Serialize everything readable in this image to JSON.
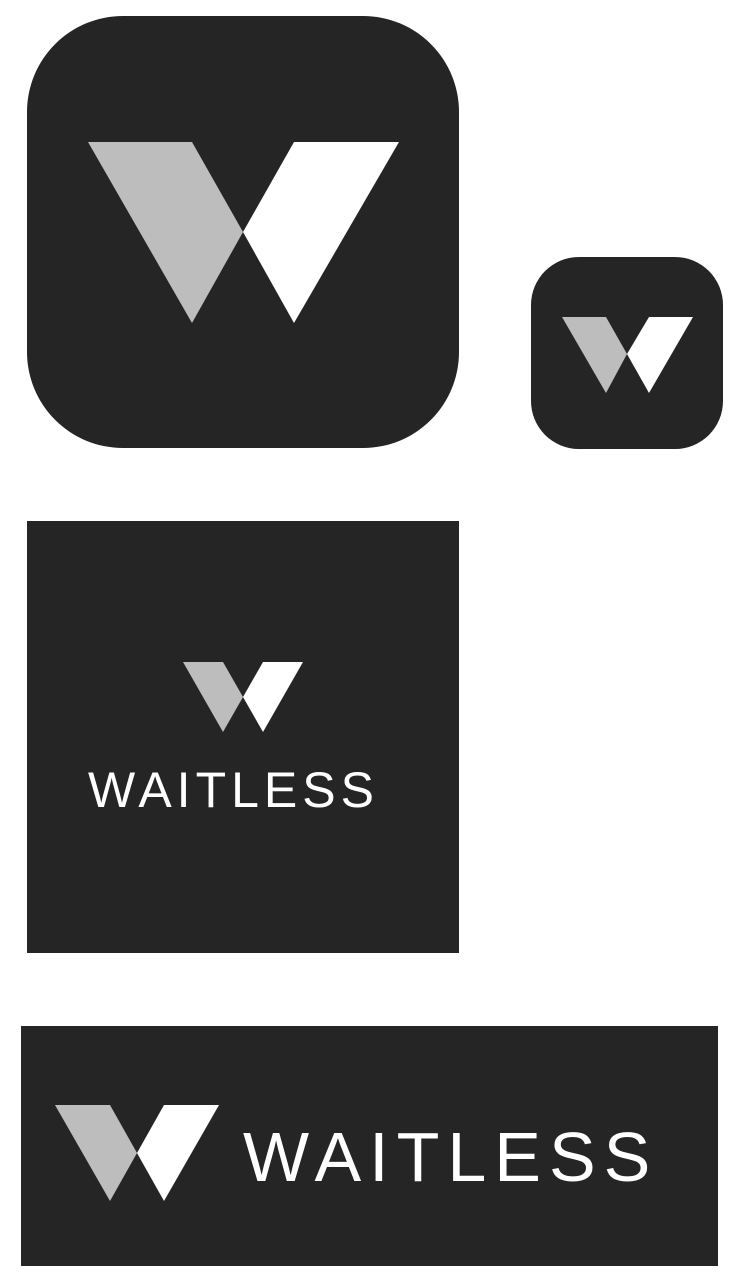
{
  "brand": {
    "wordmark": "WAITLESS",
    "logo_icon": "waitless-w-logo-icon"
  },
  "colors": {
    "tile_background": "#252525",
    "logo_left_shape": "#bdbdbd",
    "logo_right_shape": "#ffffff",
    "wordmark_text": "#ffffff",
    "page_background": "#ffffff"
  },
  "variants": [
    {
      "name": "app-icon-large",
      "shape": "rounded-square",
      "shows_wordmark": false
    },
    {
      "name": "app-icon-small",
      "shape": "rounded-square",
      "shows_wordmark": false
    },
    {
      "name": "square-logo",
      "shape": "square",
      "shows_wordmark": true,
      "layout": "stacked"
    },
    {
      "name": "horizontal-banner",
      "shape": "rectangle",
      "shows_wordmark": true,
      "layout": "inline"
    }
  ]
}
